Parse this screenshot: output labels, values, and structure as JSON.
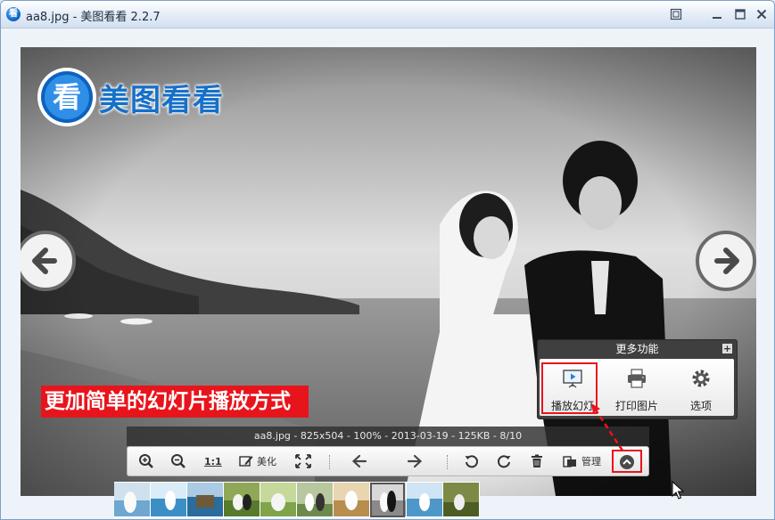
{
  "window": {
    "title": "aa8.jpg - 美图看看 2.2.7",
    "app_icon_glyph": "看",
    "controls": [
      "fit-screen-icon",
      "minimize-icon",
      "maximize-icon",
      "close-icon"
    ]
  },
  "viewer": {
    "logo_glyph": "看",
    "logo_text": "美图看看",
    "promo_banner": "更加简单的幻灯片播放方式",
    "prev_icon": "arrow-left-icon",
    "next_icon": "arrow-right-icon"
  },
  "info_bar": {
    "text": "aa8.jpg - 825x504 - 100% - 2013-03-19 - 125KB - 8/10"
  },
  "toolbar": {
    "zoom_in_icon": "zoom-in-icon",
    "zoom_out_icon": "zoom-out-icon",
    "actual_size_label": "1:1",
    "beautify_label": "美化",
    "fullscreen_icon": "expand-icon",
    "prev_icon": "arrow-left-icon",
    "next_icon": "arrow-right-icon",
    "rotate_left_icon": "rotate-left-icon",
    "rotate_right_icon": "rotate-right-icon",
    "delete_icon": "trash-icon",
    "manage_label": "管理",
    "more_icon": "chevron-up-icon"
  },
  "more_panel": {
    "title": "更多功能",
    "plus": "+",
    "items": [
      {
        "label": "播放幻灯",
        "icon": "slideshow-icon"
      },
      {
        "label": "打印图片",
        "icon": "printer-icon"
      },
      {
        "label": "选项",
        "icon": "gear-icon"
      }
    ]
  },
  "thumbnails": {
    "count": 10,
    "selected_index": 7
  },
  "colors": {
    "accent_red": "#e8141c",
    "brand_blue": "#1670c8",
    "panel_dark": "#3f3f3f"
  }
}
